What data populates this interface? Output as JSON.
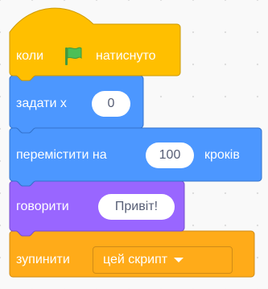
{
  "script": {
    "hat": {
      "prefix": "коли",
      "suffix": "натиснуто",
      "icon": "green-flag-icon",
      "color": "#ffbf00"
    },
    "set_x": {
      "label": "задати x",
      "value": "0",
      "color": "#4c97ff"
    },
    "move": {
      "label": "перемістити на",
      "value": "100",
      "suffix": "кроків",
      "color": "#4c97ff"
    },
    "say": {
      "label": "говорити",
      "value": "Привіт!",
      "color": "#9966ff"
    },
    "stop": {
      "label": "зупинити",
      "option": "цей скрипт",
      "color": "#ffab19"
    }
  }
}
